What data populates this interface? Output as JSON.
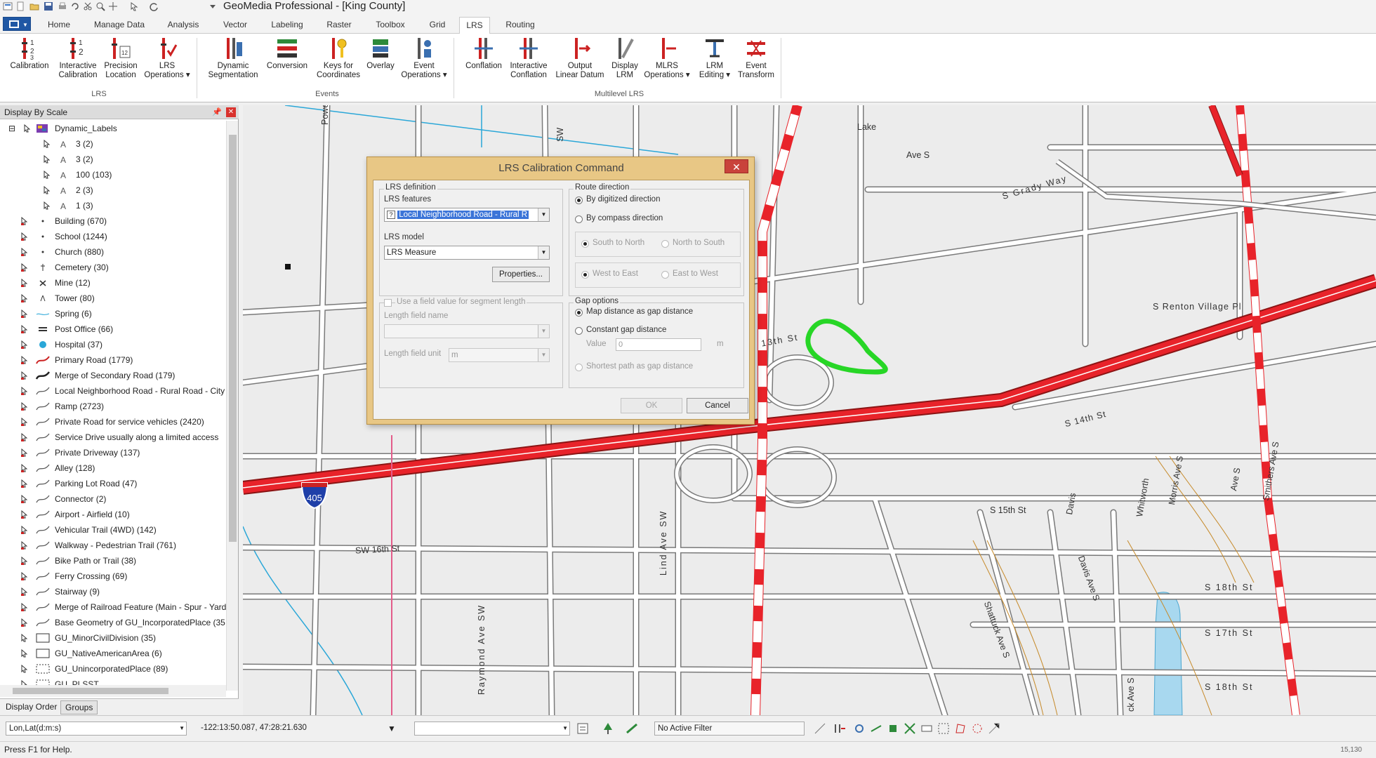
{
  "app": {
    "title": "GeoMedia Professional - [King County]"
  },
  "ribbon": {
    "tabs": [
      {
        "label": "Home"
      },
      {
        "label": "Manage Data"
      },
      {
        "label": "Analysis"
      },
      {
        "label": "Vector"
      },
      {
        "label": "Labeling"
      },
      {
        "label": "Raster"
      },
      {
        "label": "Toolbox"
      },
      {
        "label": "Grid"
      },
      {
        "label": "LRS"
      },
      {
        "label": "Routing"
      }
    ],
    "active_tab": "LRS",
    "groups": {
      "lrs": {
        "label": "LRS"
      },
      "events": {
        "label": "Events"
      },
      "multilevel": {
        "label": "Multilevel LRS"
      }
    },
    "buttons": {
      "calibration": {
        "l1": "Calibration",
        "l2": ""
      },
      "interactive_calibration": {
        "l1": "Interactive",
        "l2": "Calibration"
      },
      "precision_location": {
        "l1": "Precision",
        "l2": "Location"
      },
      "lrs_operations": {
        "l1": "LRS",
        "l2": "Operations"
      },
      "dynamic_segmentation": {
        "l1": "Dynamic",
        "l2": "Segmentation"
      },
      "conversion": {
        "l1": "Conversion",
        "l2": ""
      },
      "keys_for_coordinates": {
        "l1": "Keys for",
        "l2": "Coordinates"
      },
      "overlay": {
        "l1": "Overlay",
        "l2": ""
      },
      "event_operations": {
        "l1": "Event",
        "l2": "Operations"
      },
      "conflation": {
        "l1": "Conflation",
        "l2": ""
      },
      "interactive_conflation": {
        "l1": "Interactive",
        "l2": "Conflation"
      },
      "output_linear_datum": {
        "l1": "Output",
        "l2": "Linear Datum"
      },
      "display_lrm": {
        "l1": "Display",
        "l2": "LRM"
      },
      "mlrs_operations": {
        "l1": "MLRS",
        "l2": "Operations"
      },
      "lrm_editing": {
        "l1": "LRM",
        "l2": "Editing"
      },
      "event_transform": {
        "l1": "Event",
        "l2": "Transform"
      }
    }
  },
  "panel": {
    "title": "Display By Scale",
    "tabs": {
      "display_order": "Display Order",
      "groups": "Groups"
    },
    "items": [
      {
        "label": "Dynamic_Labels",
        "legend": "labels"
      },
      {
        "label": "3 (2)",
        "legend": "A"
      },
      {
        "label": "3 (2)",
        "legend": "A"
      },
      {
        "label": "100 (103)",
        "legend": "A"
      },
      {
        "label": "2 (3)",
        "legend": "A"
      },
      {
        "label": "1 (3)",
        "legend": "A"
      },
      {
        "label": "Building (670)",
        "legend": "dot"
      },
      {
        "label": "School (1244)",
        "legend": "dot"
      },
      {
        "label": "Church (880)",
        "legend": "dot"
      },
      {
        "label": "Cemetery (30)",
        "legend": "cross"
      },
      {
        "label": "Mine (12)",
        "legend": "mine"
      },
      {
        "label": "Tower (80)",
        "legend": "tower"
      },
      {
        "label": "Spring (6)",
        "legend": "spring"
      },
      {
        "label": "Post Office (66)",
        "legend": "post"
      },
      {
        "label": "Hospital (37)",
        "legend": "hospital"
      },
      {
        "label": "Primary Road (1779)",
        "legend": "line-red"
      },
      {
        "label": "Merge of Secondary Road (179)",
        "legend": "line-dark"
      },
      {
        "label": "Local Neighborhood Road - Rural Road - City",
        "legend": "line"
      },
      {
        "label": "Ramp (2723)",
        "legend": "line"
      },
      {
        "label": "Private Road for service vehicles (2420)",
        "legend": "line"
      },
      {
        "label": "Service Drive usually along a limited access",
        "legend": "line"
      },
      {
        "label": "Private Driveway (137)",
        "legend": "line"
      },
      {
        "label": "Alley (128)",
        "legend": "line"
      },
      {
        "label": "Parking Lot Road (47)",
        "legend": "line"
      },
      {
        "label": "Connector (2)",
        "legend": "line"
      },
      {
        "label": "Airport - Airfield (10)",
        "legend": "line"
      },
      {
        "label": "Vehicular Trail (4WD) (142)",
        "legend": "line"
      },
      {
        "label": "Walkway - Pedestrian Trail (761)",
        "legend": "line"
      },
      {
        "label": "Bike Path or Trail (38)",
        "legend": "line"
      },
      {
        "label": "Ferry Crossing (69)",
        "legend": "line"
      },
      {
        "label": "Stairway (9)",
        "legend": "line"
      },
      {
        "label": "Merge of Railroad Feature (Main - Spur - Yard",
        "legend": "line"
      },
      {
        "label": "Base Geometry of GU_IncorporatedPlace (35",
        "legend": "line"
      },
      {
        "label": "GU_MinorCivilDivision (35)",
        "legend": "area"
      },
      {
        "label": "GU_NativeAmericanArea (6)",
        "legend": "area"
      },
      {
        "label": "GU_UnincorporatedPlace (89)",
        "legend": "area-dash"
      },
      {
        "label": "GU_PLSST...",
        "legend": "area-dash"
      }
    ]
  },
  "map": {
    "labels": {
      "powell": "Powell Ave",
      "lake": "Lake",
      "ave_s_top": "Ave S",
      "grady": "S Grady Way",
      "renton": "S Renton Village Pl",
      "th13": "13th St",
      "th14": "S 14th St",
      "sw16": "SW 16th St",
      "raymond": "Raymond Ave SW",
      "lind": "Lind Ave SW",
      "s15": "S 15th St",
      "davis": "Davis",
      "davis_ave": "Davis Ave S",
      "whitworth": "Whitworth",
      "morris": "Morris Ave S",
      "smithers": "Smithers Ave S",
      "s18": "S 18th St",
      "s17": "S 17th St",
      "s18b": "S 18th St",
      "shattuck": "Shattuck Ave S",
      "sw_ave": "SW",
      "shield": "405",
      "ave_s_mid": "Ave S",
      "ave_s_bottom": "ck Ave S"
    }
  },
  "dialog": {
    "title": "LRS Calibration Command",
    "lrs_definition": {
      "legend": "LRS definition",
      "features_label": "LRS features",
      "features_value": "Local Neighborhood Road - Rural R",
      "model_label": "LRS model",
      "model_value": "LRS Measure",
      "properties_button": "Properties..."
    },
    "segment_length": {
      "checkbox_label": "Use a field value for segment length",
      "field_name_label": "Length field name",
      "field_unit_label": "Length field unit",
      "field_unit_value": "m"
    },
    "route_direction": {
      "legend": "Route direction",
      "digitized": "By digitized direction",
      "compass": "By compass direction",
      "s_to_n": "South to North",
      "n_to_s": "North to South",
      "w_to_e": "West to East",
      "e_to_w": "East to West"
    },
    "gap_options": {
      "legend": "Gap options",
      "map_distance": "Map distance as gap distance",
      "constant": "Constant gap distance",
      "value_label": "Value",
      "value": "0",
      "unit": "m",
      "shortest": "Shortest path as gap distance"
    },
    "ok_button": "OK",
    "cancel_button": "Cancel"
  },
  "bottom": {
    "coord_system": "Lon,Lat(d:m:s)",
    "coords": "-122:13:50.087, 47:28:21.630",
    "filter": "No Active Filter",
    "status": "Press F1 for Help.",
    "scale_readout": "15,130"
  }
}
